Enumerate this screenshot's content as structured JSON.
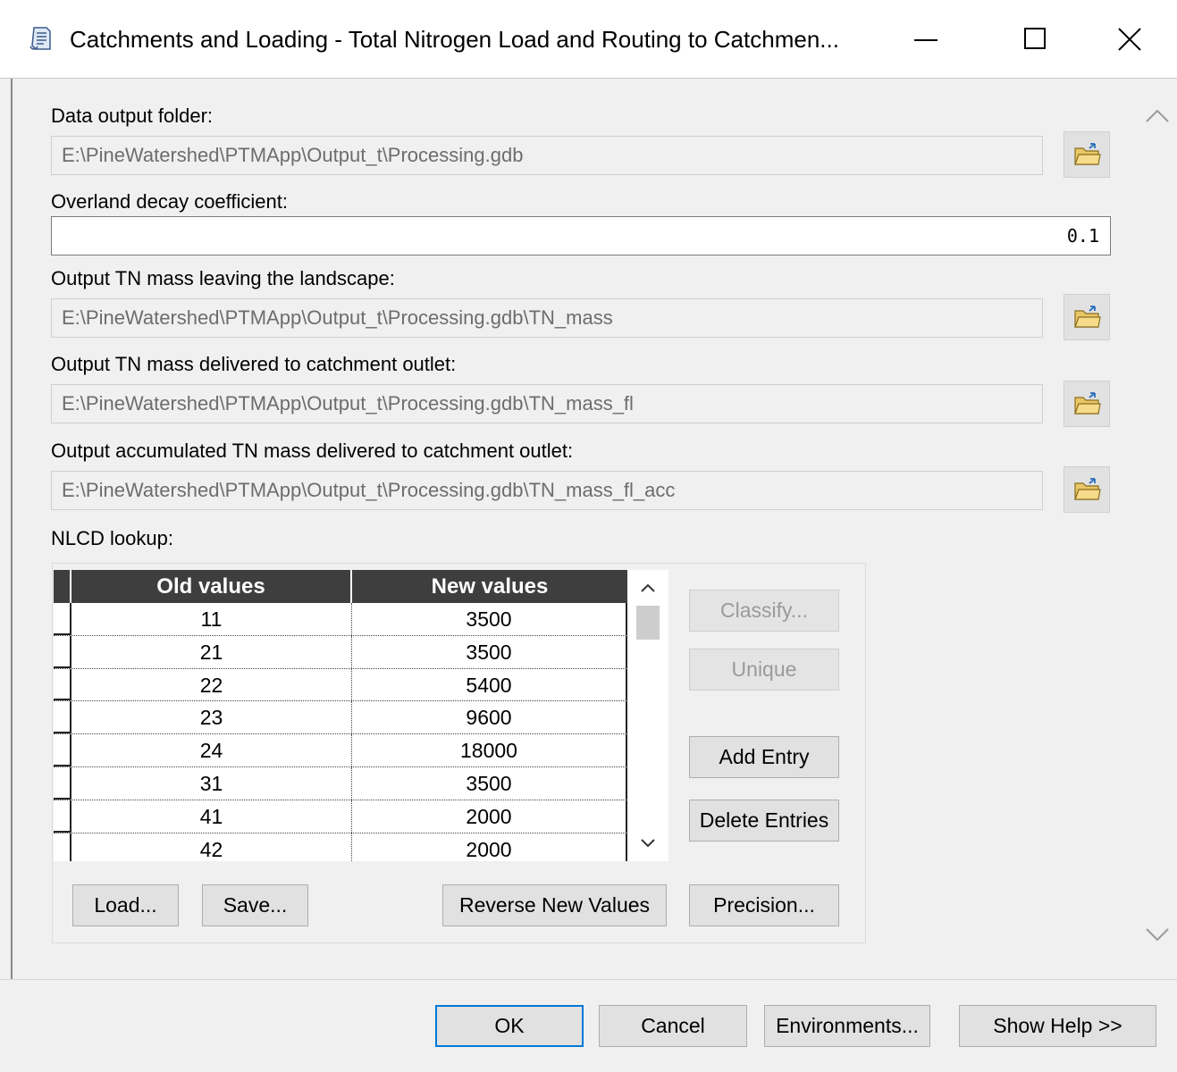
{
  "window": {
    "title": "Catchments and Loading - Total Nitrogen Load and Routing to Catchmen...",
    "minimize_symbol": "—",
    "maximize_symbol": "☐",
    "close_symbol": "✕"
  },
  "form": {
    "data_output_folder": {
      "label": "Data output folder:",
      "value": "E:\\PineWatershed\\PTMApp\\Output_t\\Processing.gdb"
    },
    "overland_decay": {
      "label": "Overland decay coefficient:",
      "value": "0.1"
    },
    "tn_mass_landscape": {
      "label": "Output TN mass leaving the landscape:",
      "value": "E:\\PineWatershed\\PTMApp\\Output_t\\Processing.gdb\\TN_mass"
    },
    "tn_mass_catchment": {
      "label": "Output TN mass delivered to catchment outlet:",
      "value": "E:\\PineWatershed\\PTMApp\\Output_t\\Processing.gdb\\TN_mass_fl"
    },
    "tn_mass_accumulated": {
      "label": "Output accumulated TN mass delivered to catchment outlet:",
      "value": "E:\\PineWatershed\\PTMApp\\Output_t\\Processing.gdb\\TN_mass_fl_acc"
    },
    "nlcd_lookup": {
      "label": "NLCD lookup:"
    }
  },
  "table": {
    "columns": [
      "Old values",
      "New values"
    ],
    "rows": [
      [
        "11",
        "3500"
      ],
      [
        "21",
        "3500"
      ],
      [
        "22",
        "5400"
      ],
      [
        "23",
        "9600"
      ],
      [
        "24",
        "18000"
      ],
      [
        "31",
        "3500"
      ],
      [
        "41",
        "2000"
      ],
      [
        "42",
        "2000"
      ]
    ]
  },
  "table_buttons": {
    "classify": "Classify...",
    "unique": "Unique",
    "add_entry": "Add Entry",
    "delete_entries": "Delete Entries",
    "load": "Load...",
    "save": "Save...",
    "reverse": "Reverse New Values",
    "precision": "Precision..."
  },
  "footer": {
    "ok": "OK",
    "cancel": "Cancel",
    "environments": "Environments...",
    "show_help": "Show Help >>"
  },
  "icons": {
    "app": "tool-script-icon",
    "browse": "open-folder-icon"
  },
  "colors": {
    "header_bg": "#3e3e3e",
    "default_button_border": "#0078d7"
  }
}
